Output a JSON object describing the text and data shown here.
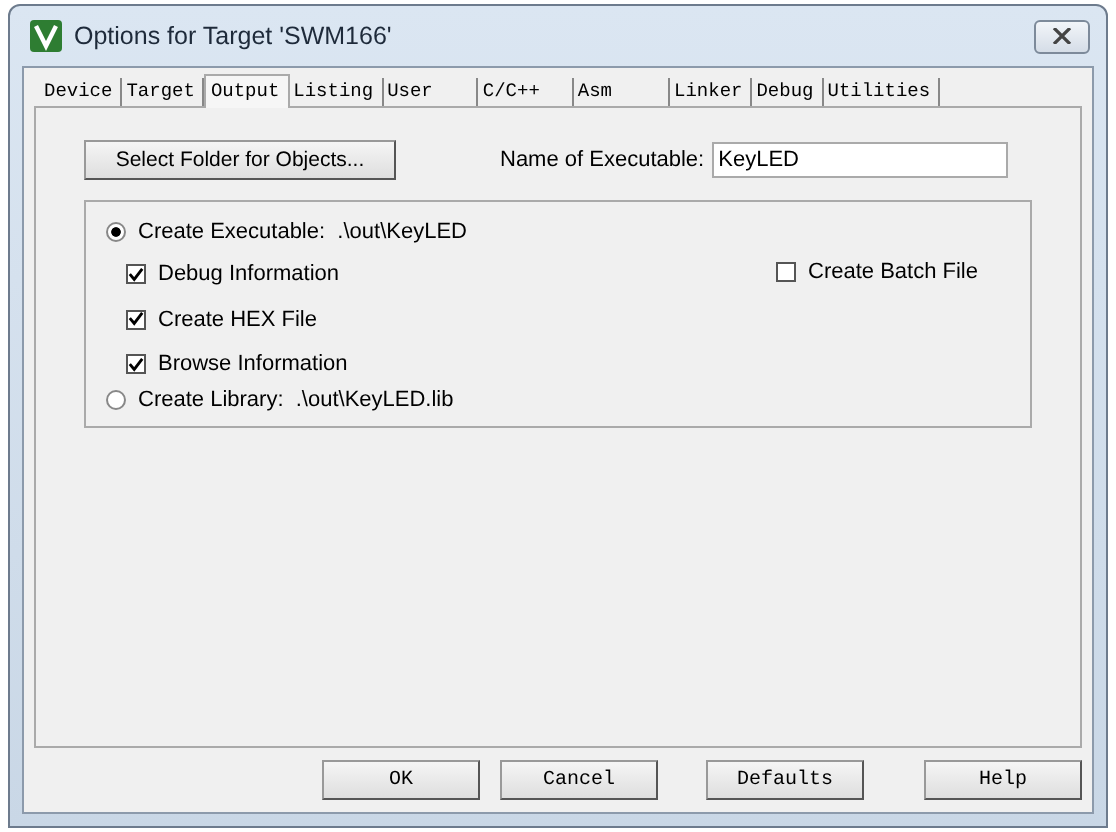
{
  "window": {
    "title": "Options for Target 'SWM166'"
  },
  "tabs": [
    {
      "label": "Device",
      "selected": false
    },
    {
      "label": "Target",
      "selected": false
    },
    {
      "label": "Output",
      "selected": true
    },
    {
      "label": "Listing",
      "selected": false
    },
    {
      "label": "User",
      "selected": false
    },
    {
      "label": "C/C++",
      "selected": false
    },
    {
      "label": "Asm",
      "selected": false
    },
    {
      "label": "Linker",
      "selected": false
    },
    {
      "label": "Debug",
      "selected": false
    },
    {
      "label": "Utilities",
      "selected": false
    }
  ],
  "select_folder_button": "Select Folder for Objects...",
  "name_of_executable": {
    "label": "Name of Executable:",
    "value": "KeyLED"
  },
  "executable": {
    "label": "Create Executable:",
    "path": ".\\out\\KeyLED",
    "selected": true
  },
  "checks": [
    {
      "label": "Debug Information",
      "checked": true
    },
    {
      "label": "Create HEX File",
      "checked": true
    },
    {
      "label": "Browse Information",
      "checked": true
    }
  ],
  "batch_file": {
    "label": "Create Batch File",
    "checked": false
  },
  "library": {
    "label": "Create Library:",
    "path": ".\\out\\KeyLED.lib",
    "selected": false
  },
  "buttons": [
    "OK",
    "Cancel",
    "Defaults",
    "Help"
  ]
}
